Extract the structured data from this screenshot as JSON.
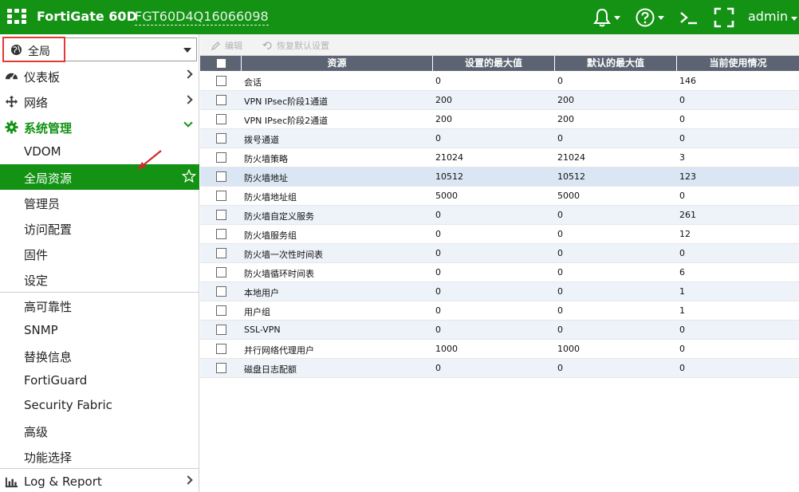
{
  "header": {
    "product": "FortiGate 60D",
    "serial": "FGT60D4Q16066098",
    "user": "admin"
  },
  "sidebar": {
    "vdom_selector": "全局",
    "items": [
      {
        "label": "仪表板",
        "icon": "dashboard-icon"
      },
      {
        "label": "网络",
        "icon": "network-move-icon"
      },
      {
        "label": "系统管理",
        "icon": "gear-icon"
      }
    ],
    "sub_items": [
      "VDOM",
      "全局资源",
      "管理员",
      "访问配置",
      "固件",
      "设定"
    ],
    "sub_items2": [
      "高可靠性",
      "SNMP",
      "替换信息",
      "FortiGuard",
      "Security Fabric",
      "高级",
      "功能选择"
    ],
    "bottom_item": {
      "label": "Log & Report",
      "icon": "bar-chart-icon"
    }
  },
  "toolbar": {
    "edit": "编辑",
    "reset": "恢复默认设置"
  },
  "table": {
    "columns": [
      "资源",
      "设置的最大值",
      "默认的最大值",
      "当前使用情况"
    ],
    "rows": [
      [
        "会话",
        "0",
        "0",
        "146"
      ],
      [
        "VPN IPsec阶段1通道",
        "200",
        "200",
        "0"
      ],
      [
        "VPN IPsec阶段2通道",
        "200",
        "200",
        "0"
      ],
      [
        "拨号通道",
        "0",
        "0",
        "0"
      ],
      [
        "防火墙策略",
        "21024",
        "21024",
        "3"
      ],
      [
        "防火墙地址",
        "10512",
        "10512",
        "123"
      ],
      [
        "防火墙地址组",
        "5000",
        "5000",
        "0"
      ],
      [
        "防火墙自定义服务",
        "0",
        "0",
        "261"
      ],
      [
        "防火墙服务组",
        "0",
        "0",
        "12"
      ],
      [
        "防火墙一次性时间表",
        "0",
        "0",
        "0"
      ],
      [
        "防火墙循环时间表",
        "0",
        "0",
        "6"
      ],
      [
        "本地用户",
        "0",
        "0",
        "1"
      ],
      [
        "用户组",
        "0",
        "0",
        "1"
      ],
      [
        "SSL-VPN",
        "0",
        "0",
        "0"
      ],
      [
        "并行网络代理用户",
        "1000",
        "1000",
        "0"
      ],
      [
        "磁盘日志配额",
        "0",
        "0",
        "0"
      ]
    ]
  },
  "colors": {
    "brand_green": "#139214",
    "table_header": "#5c6473",
    "highlight_border": "#e53935"
  }
}
